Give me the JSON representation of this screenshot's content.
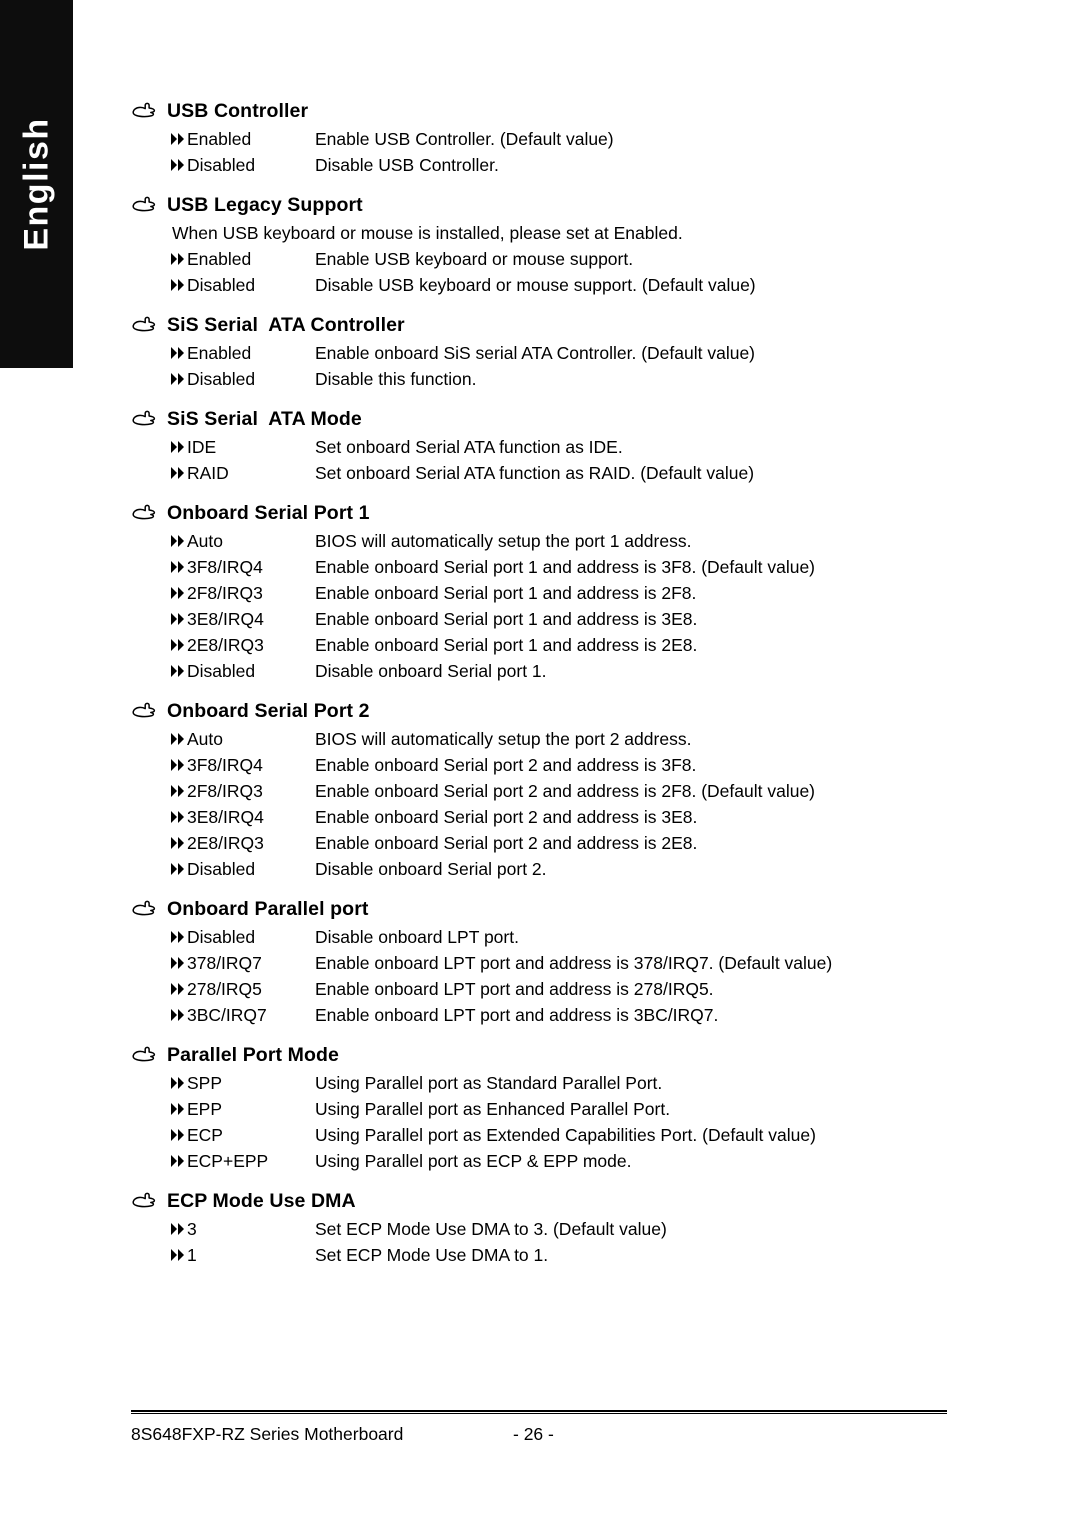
{
  "sidebar": {
    "language_label": "English"
  },
  "icons": {
    "heading_bullet": "pointing-hand-icon",
    "option_bullet": "double-triangle-icon"
  },
  "sections": [
    {
      "id": "usb-controller",
      "heading": "USB Controller",
      "note": null,
      "options": [
        {
          "label": "Enabled",
          "desc": "Enable USB Controller. (Default value)"
        },
        {
          "label": "Disabled",
          "desc": "Disable USB Controller."
        }
      ]
    },
    {
      "id": "usb-legacy-support",
      "heading": "USB Legacy Support",
      "note": "When USB keyboard or mouse is installed, please set at Enabled.",
      "options": [
        {
          "label": "Enabled",
          "desc": "Enable USB keyboard or mouse support."
        },
        {
          "label": "Disabled",
          "desc": "Disable USB keyboard or mouse support. (Default value)"
        }
      ]
    },
    {
      "id": "sis-serial-ata-controller",
      "heading": "SiS Serial  ATA Controller",
      "note": null,
      "options": [
        {
          "label": "Enabled",
          "desc": "Enable onboard SiS serial ATA Controller. (Default value)"
        },
        {
          "label": "Disabled",
          "desc": "Disable this function."
        }
      ]
    },
    {
      "id": "sis-serial-ata-mode",
      "heading": "SiS Serial  ATA Mode",
      "note": null,
      "options": [
        {
          "label": "IDE",
          "desc": "Set onboard Serial ATA function as IDE."
        },
        {
          "label": "RAID",
          "desc": "Set onboard Serial ATA function as RAID. (Default value)"
        }
      ]
    },
    {
      "id": "onboard-serial-port-1",
      "heading": "Onboard Serial Port 1",
      "note": null,
      "options": [
        {
          "label": "Auto",
          "desc": "BIOS will automatically setup the port 1 address."
        },
        {
          "label": "3F8/IRQ4",
          "desc": "Enable onboard Serial port 1 and address is 3F8. (Default value)"
        },
        {
          "label": "2F8/IRQ3",
          "desc": "Enable onboard Serial port 1 and address is 2F8."
        },
        {
          "label": "3E8/IRQ4",
          "desc": "Enable onboard Serial port 1 and address is 3E8."
        },
        {
          "label": "2E8/IRQ3",
          "desc": "Enable onboard Serial port 1 and address is 2E8."
        },
        {
          "label": "Disabled",
          "desc": "Disable onboard Serial port 1."
        }
      ]
    },
    {
      "id": "onboard-serial-port-2",
      "heading": "Onboard Serial Port 2",
      "note": null,
      "options": [
        {
          "label": "Auto",
          "desc": "BIOS will automatically setup the port 2 address."
        },
        {
          "label": "3F8/IRQ4",
          "desc": "Enable onboard Serial port 2 and address is 3F8."
        },
        {
          "label": "2F8/IRQ3",
          "desc": "Enable onboard Serial port 2 and address is 2F8. (Default value)"
        },
        {
          "label": "3E8/IRQ4",
          "desc": "Enable onboard Serial port 2 and address is 3E8."
        },
        {
          "label": "2E8/IRQ3",
          "desc": "Enable onboard Serial port 2 and address is 2E8."
        },
        {
          "label": "Disabled",
          "desc": "Disable onboard Serial port 2."
        }
      ]
    },
    {
      "id": "onboard-parallel-port",
      "heading": "Onboard Parallel port",
      "note": null,
      "options": [
        {
          "label": "Disabled",
          "desc": "Disable onboard LPT port."
        },
        {
          "label": "378/IRQ7",
          "desc": "Enable onboard LPT port and address is 378/IRQ7. (Default value)"
        },
        {
          "label": "278/IRQ5",
          "desc": "Enable onboard LPT port and address is 278/IRQ5."
        },
        {
          "label": "3BC/IRQ7",
          "desc": "Enable onboard LPT port and address is 3BC/IRQ7."
        }
      ]
    },
    {
      "id": "parallel-port-mode",
      "heading": "Parallel Port Mode",
      "note": null,
      "options": [
        {
          "label": "SPP",
          "desc": "Using Parallel port as Standard Parallel Port."
        },
        {
          "label": "EPP",
          "desc": "Using Parallel port as Enhanced Parallel Port."
        },
        {
          "label": "ECP",
          "desc": "Using Parallel port as Extended Capabilities Port. (Default value)"
        },
        {
          "label": "ECP+EPP",
          "desc": "Using Parallel port as ECP & EPP mode."
        }
      ]
    },
    {
      "id": "ecp-mode-use-dma",
      "heading": "ECP Mode Use DMA",
      "note": null,
      "options": [
        {
          "label": "3",
          "desc": "Set ECP Mode Use DMA to 3. (Default value)"
        },
        {
          "label": "1",
          "desc": "Set ECP Mode Use DMA to 1."
        }
      ]
    }
  ],
  "footer": {
    "title": "8S648FXP-RZ Series Motherboard",
    "page": "- 26 -"
  }
}
